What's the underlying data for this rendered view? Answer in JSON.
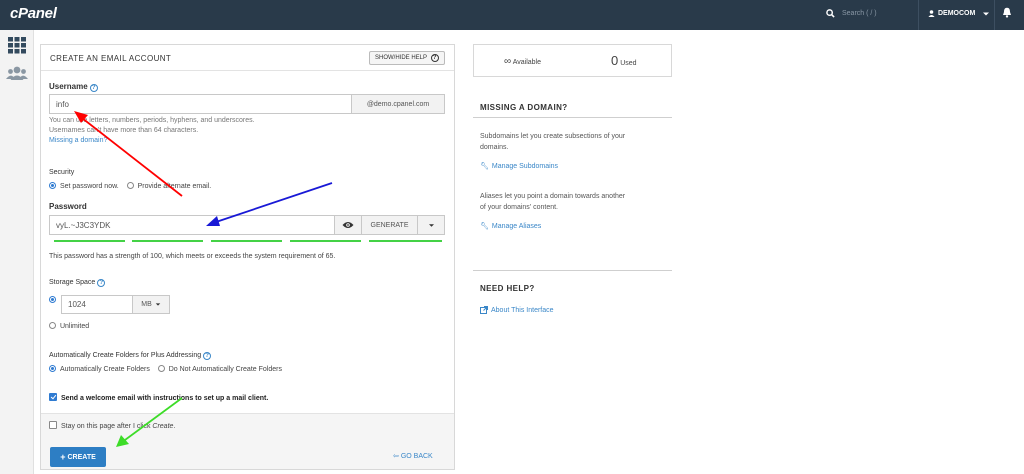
{
  "topbar": {
    "logo": "cPanel",
    "search_placeholder": "Search ( / )",
    "user": "DEMOCOM"
  },
  "panel": {
    "title": "CREATE AN EMAIL ACCOUNT",
    "help_button": "SHOW/HIDE HELP"
  },
  "username": {
    "label": "Username",
    "value": "info",
    "domain": "@demo.cpanel.com",
    "help_line1": "You can use letters, numbers, periods, hyphens, and underscores.",
    "help_line2": "Usernames can't have more than 64 characters.",
    "missing_domain_link": "Missing a domain?"
  },
  "security": {
    "label": "Security",
    "option_set": "Set password now.",
    "option_alt": "Provide alternate email.",
    "selected": "set"
  },
  "password": {
    "label": "Password",
    "value": "vyL.~J3C3YDK",
    "generate_label": "GENERATE",
    "strength_text": "This password has a strength of 100, which meets or exceeds the system requirement of 65.",
    "strength": 100
  },
  "storage": {
    "label": "Storage Space",
    "value": "1024",
    "unit": "MB",
    "unlimited_label": "Unlimited"
  },
  "plus_addressing": {
    "label": "Automatically Create Folders for Plus Addressing",
    "option_auto": "Automatically Create Folders",
    "option_none": "Do Not Automatically Create Folders"
  },
  "welcome_email": {
    "label": "Send a welcome email with instructions to set up a mail client.",
    "checked": true
  },
  "footer": {
    "stay_prefix": "Stay on this page after I click ",
    "stay_em": "Create",
    "stay_suffix": ".",
    "create_label": "CREATE",
    "goback_label": "GO BACK"
  },
  "stats": {
    "available_symbol": "∞",
    "available_label": "Available",
    "used_value": "0",
    "used_label": "Used"
  },
  "sidebar": {
    "missing_title": "MISSING A DOMAIN?",
    "subdomains_text_1": "Subdomains let you create subsections of your",
    "subdomains_text_2": "domains.",
    "manage_subdomains": "Manage Subdomains",
    "aliases_text_1": "Aliases let you point a domain towards another",
    "aliases_text_2": "of your domains' content.",
    "manage_aliases": "Manage Aliases",
    "help_title": "NEED HELP?",
    "about_link": "About This Interface"
  },
  "colors": {
    "topbar": "#293a4a",
    "accent": "#2d7ec4",
    "link": "#3a87c8",
    "strength_bar": "#44d246",
    "arrow_red": "#ff0000",
    "arrow_blue": "#1919d6",
    "arrow_green": "#3ddc28"
  }
}
